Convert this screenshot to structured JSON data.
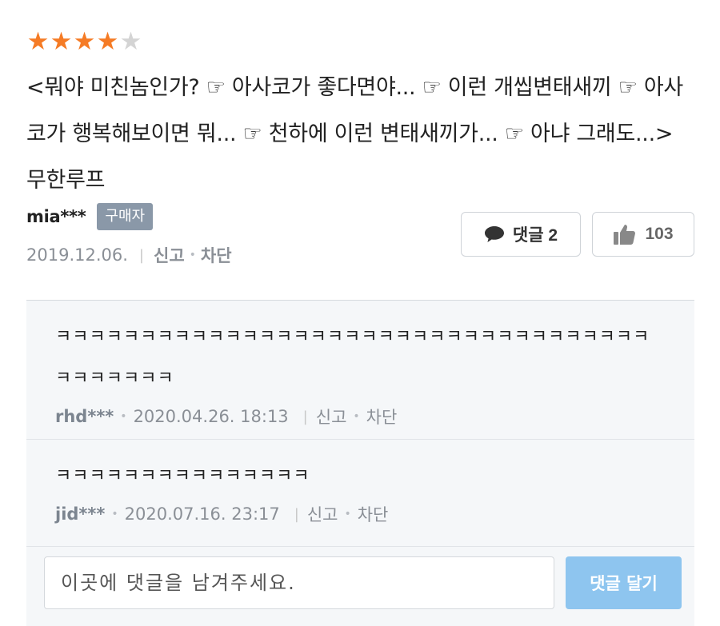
{
  "review": {
    "rating": 4,
    "max_rating": 5,
    "text": "<뭐야 미친놈인가? ☞ 아사코가 좋다면야... ☞ 이런 개씹변태새끼 ☞ 아사코가 행복해보이면 뭐... ☞ 천하에 이런 변태새끼가... ☞ 아냐 그래도...>무한루프",
    "author": "mia***",
    "buyer_badge": "구매자",
    "date": "2019.12.06.",
    "sep": "|",
    "report_label": "신고",
    "block_label": "차단",
    "dot": "•",
    "comment_button_label": "댓글 2",
    "like_count": "103"
  },
  "comments": [
    {
      "text": "ㅋㅋㅋㅋㅋㅋㅋㅋㅋㅋㅋㅋㅋㅋㅋㅋㅋㅋㅋㅋㅋㅋㅋㅋㅋㅋㅋㅋㅋㅋㅋㅋㅋㅋㅋㅋㅋㅋㅋㅋㅋㅋ",
      "author": "rhd***",
      "date": "2020.04.26. 18:13",
      "report_label": "신고",
      "block_label": "차단"
    },
    {
      "text": "ㅋㅋㅋㅋㅋㅋㅋㅋㅋㅋㅋㅋㅋㅋㅋ",
      "author": "jid***",
      "date": "2020.07.16. 23:17",
      "report_label": "신고",
      "block_label": "차단"
    }
  ],
  "comment_form": {
    "placeholder": "이곳에 댓글을 남겨주세요.",
    "submit_label": "댓글 달기"
  },
  "colors": {
    "star_on": "#f57b25",
    "star_off": "#d4d4d4",
    "buyer_badge_bg": "#8a98a8",
    "submit_bg": "#8ec5ef"
  },
  "icons": {
    "star": "star-icon",
    "comment": "speech-bubble-icon",
    "like": "thumbs-up-icon"
  }
}
